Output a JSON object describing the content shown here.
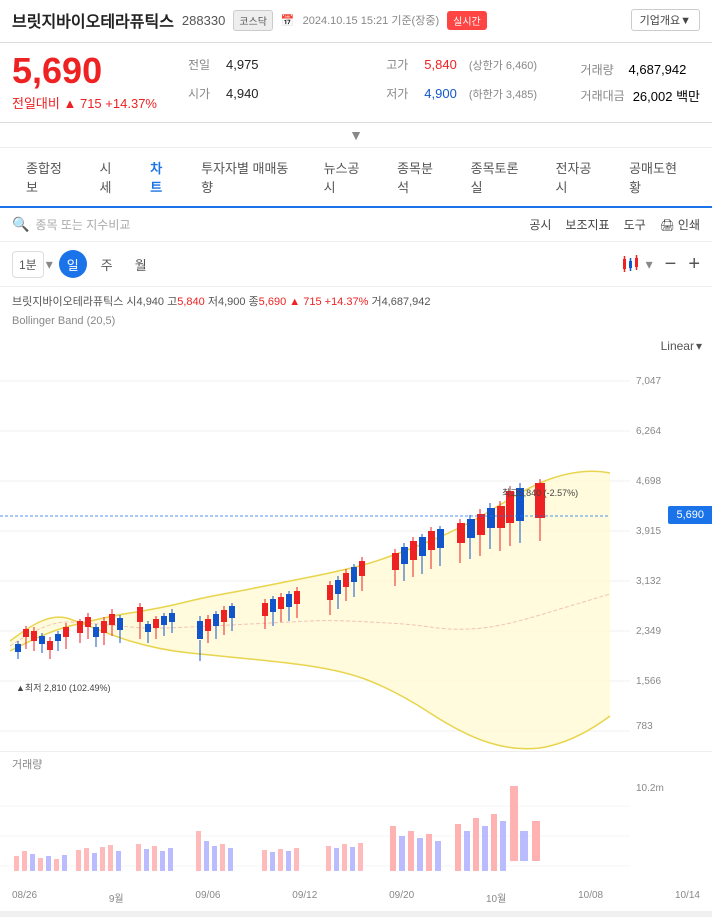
{
  "header": {
    "stock_name": "브릿지바이오테라퓨틱스",
    "stock_code": "288330",
    "market": "코스닥",
    "date_info": "2024.10.15 15:21 기준(장중)",
    "realtime_label": "실시간",
    "company_btn": "기업개요▼"
  },
  "price": {
    "current": "5,690",
    "change_icon": "▲",
    "change_amount": "715",
    "change_pct": "+14.37%",
    "prev_close_label": "전일",
    "prev_close": "4,975",
    "high_label": "고가",
    "high": "5,840",
    "high_sub": "(상한가 6,460)",
    "volume_label": "거래량",
    "volume": "4,687,942",
    "open_label": "시가",
    "open": "4,940",
    "low_label": "저가",
    "low": "4,900",
    "low_sub": "(하한가 3,485)",
    "amount_label": "거래대금",
    "amount": "26,002 백만"
  },
  "nav_tabs": [
    "종합정보",
    "시세",
    "차트",
    "투자자별 매매동향",
    "뉴스공시",
    "종목분석",
    "종목토론실",
    "전자공시",
    "공매도현황"
  ],
  "active_tab": "차트",
  "toolbar": {
    "search_placeholder": "종목 또는 지수비교",
    "announcement": "공시",
    "indicators": "보조지표",
    "tools": "도구",
    "print": "인쇄"
  },
  "chart_controls": {
    "time_options": [
      "1분",
      "일",
      "주",
      "월"
    ],
    "active_time": "일"
  },
  "chart_info": {
    "name": "브릿지바이오테라퓨틱스",
    "open": "4,940",
    "high": "5,840",
    "low": "4,900",
    "close": "5,690",
    "change": "715",
    "change_pct": "+14.37%",
    "volume": "4,687,942"
  },
  "bollinger": "Bollinger Band (20,5)",
  "linear_label": "Linear",
  "chart": {
    "price_badge": "5,690",
    "high_annotation": "최고5,840 (-2.57%)",
    "low_annotation": "▲최저 2,810 (102.49%)",
    "y_labels": [
      "7,047",
      "6,264",
      "5,690",
      "4,698",
      "3,915",
      "3,132",
      "2,349",
      "1,566",
      "783"
    ],
    "y_current": "5,690"
  },
  "volume_section": {
    "label": "거래량",
    "max_label": "10.2m"
  },
  "x_axis_labels": [
    "08/26",
    "9월",
    "09/06",
    "09/12",
    "09/20",
    "10월",
    "10/08",
    "10/14"
  ]
}
